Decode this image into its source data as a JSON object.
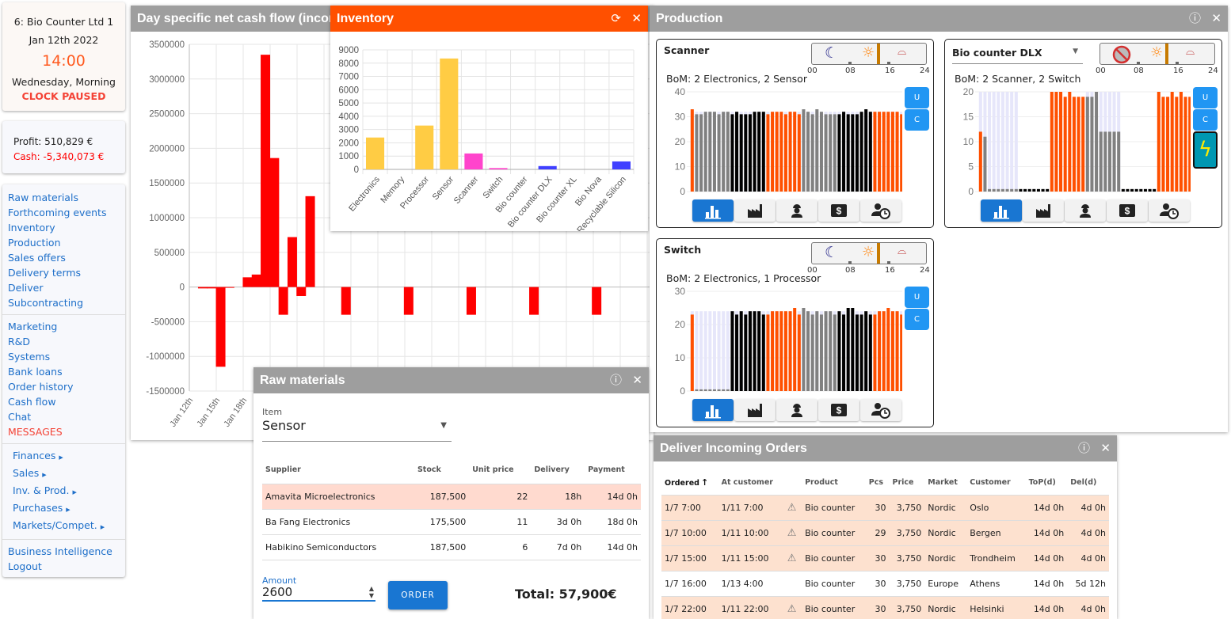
{
  "status": {
    "company": "6: Bio Counter Ltd 1",
    "date": "Jan 12th 2022",
    "time": "14:00",
    "daypart": "Wednesday, Morning",
    "clock_state": "CLOCK PAUSED"
  },
  "finance": {
    "profit": "Profit: 510,829 €",
    "cash": "Cash: -5,340,073 €"
  },
  "nav": {
    "group1": [
      "Raw materials",
      "Forthcoming events",
      "Inventory",
      "Production",
      "Sales offers",
      "Delivery terms",
      "Deliver",
      "Subcontracting"
    ],
    "group2": [
      "Marketing",
      "R&D",
      "Systems",
      "Bank loans",
      "Order history",
      "Cash flow",
      "Chat"
    ],
    "messages": "MESSAGES",
    "group3": [
      "Finances",
      "Sales",
      "Inv. & Prod.",
      "Purchases",
      "Markets/Compet."
    ],
    "group4": [
      "Business Intelligence",
      "Logout"
    ]
  },
  "colors": {
    "accent_orange": "#ff5000",
    "panel_header": "#9e9e9e",
    "link": "#1e6fc9",
    "alert": "#f44336",
    "button_blue": "#1976d2"
  },
  "cashflow": {
    "title": "Day specific net cash flow (incom",
    "chart_data": {
      "type": "bar",
      "ylim": [
        -1500000,
        3500000
      ],
      "yticks": [
        3500000,
        3000000,
        2500000,
        2000000,
        1500000,
        1000000,
        500000,
        0,
        -500000,
        -1000000,
        -1500000
      ],
      "xtick_labels": [
        "Jan 12th",
        "Jan 15th",
        "Jan 18th",
        "J"
      ],
      "grid": true,
      "color": "#ff0000",
      "x": [
        "Jan 13th",
        "Jan 14th",
        "Jan 15th",
        "Jan 16th",
        "Jan 18th",
        "Jan 19th",
        "Jan 20th",
        "Jan 21st",
        "Jan 22nd",
        "Jan 23rd",
        "Jan 24th",
        "Jan 25th",
        "Jan 29th",
        "Feb 5th",
        "Feb 12th",
        "Feb 19th",
        "Feb 26th"
      ],
      "values": [
        -20000,
        -20000,
        -1150000,
        -10000,
        140000,
        180000,
        3350000,
        1860000,
        -400000,
        720000,
        -130000,
        1310000,
        -400000,
        -400000,
        -400000,
        -400000,
        -400000
      ]
    }
  },
  "inventory": {
    "title": "Inventory",
    "chart_data": {
      "type": "bar",
      "ylim": [
        0,
        9000
      ],
      "yticks": [
        0,
        1000,
        2000,
        3000,
        4000,
        5000,
        6000,
        7000,
        8000,
        9000
      ],
      "grid": true,
      "categories": [
        "Electronics",
        "Memory",
        "Processor",
        "Sensor",
        "Scanner",
        "Switch",
        "Bio counter",
        "Bio counter DLX",
        "Bio counter XL",
        "Bio Nova",
        "Recyclable Silicon"
      ],
      "values": [
        2400,
        0,
        3300,
        8350,
        1200,
        100,
        0,
        250,
        0,
        0,
        600
      ],
      "colors": [
        "#ffcc44",
        "#ffcc44",
        "#ffcc44",
        "#ffcc44",
        "#ff44cc",
        "#ff44cc",
        "#4040ff",
        "#4040ff",
        "#4040ff",
        "#4040ff",
        "#4040ff"
      ]
    }
  },
  "production": {
    "title": "Production",
    "timeline_ticks": [
      "00",
      "08",
      "16",
      "24"
    ],
    "current_hour": 14,
    "button_u": "U",
    "button_c": "C",
    "bar_colors": {
      "o": "#ff5000",
      "g": "#808080",
      "k": "#000000",
      "cap": "#e6e6fa"
    },
    "lines": [
      {
        "title": "Scanner",
        "bom": "BoM: 2 Electronics, 2 Sensor",
        "night_disabled": false,
        "boost": false,
        "chart_data": {
          "type": "bar",
          "ylim": [
            0,
            40
          ],
          "yticks": [
            0,
            10,
            20,
            30,
            40
          ],
          "capacity": 32,
          "values": [
            33,
            31,
            31,
            32,
            32,
            32,
            31,
            32,
            32,
            31,
            32,
            31,
            31,
            31,
            32,
            32,
            32,
            31,
            32,
            32,
            32,
            31,
            32,
            32,
            31,
            33,
            32,
            31,
            33,
            32,
            31,
            31,
            31,
            31,
            32,
            31,
            31,
            31,
            32,
            33,
            32,
            32,
            32,
            32,
            32,
            32,
            32,
            31
          ],
          "colors": "ogggggggg"
        }
      },
      {
        "title": "Bio counter DLX",
        "bom": "BoM: 2 Scanner, 2 Switch",
        "night_disabled": true,
        "boost": true,
        "chart_data": {
          "type": "bar",
          "ylim": [
            0,
            20
          ],
          "yticks": [
            0,
            5,
            10,
            15,
            20
          ],
          "capacity": 20,
          "values": [
            12,
            11,
            0.5,
            0.5,
            0.5,
            0.5,
            0.5,
            0.5,
            0.5,
            0.5,
            0.5,
            0.5,
            0.5,
            0.5,
            0.5,
            0.5,
            20,
            20,
            20,
            19,
            20,
            19,
            19,
            19,
            19,
            19,
            20,
            12,
            12,
            12,
            12,
            12,
            0.5,
            0.5,
            0.5,
            0.5,
            0.5,
            0.5,
            0.5,
            0.5,
            20,
            19,
            19,
            20,
            19,
            20,
            19,
            19
          ],
          "colors": ""
        }
      },
      {
        "title": "Switch",
        "bom": "BoM: 2 Electronics, 1 Processor",
        "night_disabled": false,
        "boost": false,
        "chart_data": {
          "type": "bar",
          "ylim": [
            0,
            30
          ],
          "yticks": [
            0,
            10,
            20,
            30
          ],
          "capacity": 24,
          "values": [
            23,
            0.5,
            0.5,
            0.5,
            0.5,
            0.5,
            0.5,
            0.5,
            0.5,
            24,
            23,
            24,
            23,
            24,
            24,
            24,
            23,
            23,
            24,
            24,
            24,
            24,
            24,
            25,
            23,
            25,
            24,
            23,
            24,
            23,
            24,
            24,
            23,
            24,
            23,
            25,
            25,
            23,
            23,
            24,
            23,
            23,
            24,
            24,
            25,
            24,
            24,
            23
          ],
          "colors": ""
        }
      }
    ]
  },
  "raw": {
    "title": "Raw materials",
    "item_label": "Item",
    "item_value": "Sensor",
    "columns": [
      "Supplier",
      "Stock",
      "Unit price",
      "Delivery",
      "Payment"
    ],
    "rows": [
      [
        "Amavita Microelectronics",
        "187,500",
        "22",
        "18h",
        "14d 0h"
      ],
      [
        "Ba Fang Electronics",
        "175,500",
        "11",
        "3d 0h",
        "18d 0h"
      ],
      [
        "Habikino Semiconductors",
        "187,500",
        "6",
        "7d 0h",
        "14d 0h"
      ]
    ],
    "amount_label": "Amount",
    "amount_value": "2600",
    "order_button": "ORDER",
    "total": "Total: 57,900€"
  },
  "deliver": {
    "title": "Deliver Incoming Orders",
    "columns": [
      "Ordered",
      "At customer",
      "",
      "Product",
      "Pcs",
      "Price",
      "Market",
      "Customer",
      "ToP(d)",
      "Del(d)"
    ],
    "rows": [
      {
        "ordered": "1/7 7:00",
        "at": "1/11 7:00",
        "warn": true,
        "product": "Bio counter",
        "pcs": "30",
        "price": "3,750",
        "market": "Nordic",
        "customer": "Oslo",
        "top": "14d 0h",
        "del": "4d 0h"
      },
      {
        "ordered": "1/7 10:00",
        "at": "1/11 10:00",
        "warn": true,
        "product": "Bio counter",
        "pcs": "29",
        "price": "3,750",
        "market": "Nordic",
        "customer": "Bergen",
        "top": "14d 0h",
        "del": "4d 0h"
      },
      {
        "ordered": "1/7 15:00",
        "at": "1/11 15:00",
        "warn": true,
        "product": "Bio counter",
        "pcs": "30",
        "price": "3,750",
        "market": "Nordic",
        "customer": "Trondheim",
        "top": "14d 0h",
        "del": "4d 0h"
      },
      {
        "ordered": "1/7 16:00",
        "at": "1/13 4:00",
        "warn": false,
        "product": "Bio counter",
        "pcs": "30",
        "price": "3,750",
        "market": "Europe",
        "customer": "Athens",
        "top": "14d 0h",
        "del": "5d 12h"
      },
      {
        "ordered": "1/7 22:00",
        "at": "1/11 22:00",
        "warn": true,
        "product": "Bio counter",
        "pcs": "30",
        "price": "3,750",
        "market": "Nordic",
        "customer": "Helsinki",
        "top": "14d 0h",
        "del": "4d 0h"
      }
    ]
  }
}
